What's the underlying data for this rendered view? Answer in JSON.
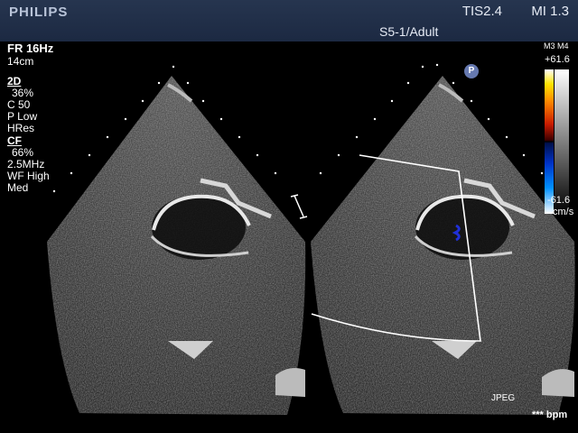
{
  "header": {
    "brand": "PHILIPS",
    "tis": "TIS2.4",
    "mi": "MI 1.3",
    "probe_preset": "S5-1/Adult"
  },
  "params": {
    "frame_rate": "FR 16Hz",
    "depth": "14cm",
    "mode_2d": "2D",
    "gain_2d": "36%",
    "compression": "C 50",
    "power": "P Low",
    "resolution": "HRes",
    "mode_cf": "CF",
    "gain_cf": "66%",
    "frequency": "2.5MHz",
    "wall_filter": "WF High",
    "flow": "Med"
  },
  "color_scale": {
    "map": "M3 M4",
    "max": "+61.6",
    "min": "-61.6",
    "unit": "cm/s"
  },
  "badge": "P",
  "format": "JPEG",
  "heart_rate": "*** bpm"
}
